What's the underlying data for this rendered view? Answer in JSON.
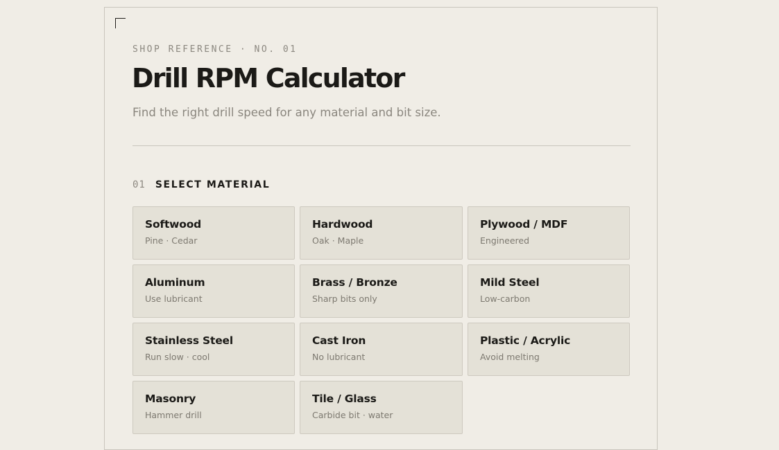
{
  "header": {
    "eyebrow": "SHOP REFERENCE · NO. 01",
    "title": "Drill RPM Calculator",
    "subtitle": "Find the right drill speed for any material and bit size."
  },
  "section": {
    "number": "01",
    "label": "SELECT MATERIAL"
  },
  "materials": [
    {
      "name": "Softwood",
      "note": "Pine · Cedar"
    },
    {
      "name": "Hardwood",
      "note": "Oak · Maple"
    },
    {
      "name": "Plywood / MDF",
      "note": "Engineered"
    },
    {
      "name": "Aluminum",
      "note": "Use lubricant"
    },
    {
      "name": "Brass / Bronze",
      "note": "Sharp bits only"
    },
    {
      "name": "Mild Steel",
      "note": "Low-carbon"
    },
    {
      "name": "Stainless Steel",
      "note": "Run slow · cool"
    },
    {
      "name": "Cast Iron",
      "note": "No lubricant"
    },
    {
      "name": "Plastic / Acrylic",
      "note": "Avoid melting"
    },
    {
      "name": "Masonry",
      "note": "Hammer drill"
    },
    {
      "name": "Tile / Glass",
      "note": "Carbide bit · water"
    }
  ],
  "colors": {
    "background": "#f0ede6",
    "card_fill": "#e4e1d7",
    "text_primary": "#1b1a17",
    "text_muted": "#8a867e"
  }
}
